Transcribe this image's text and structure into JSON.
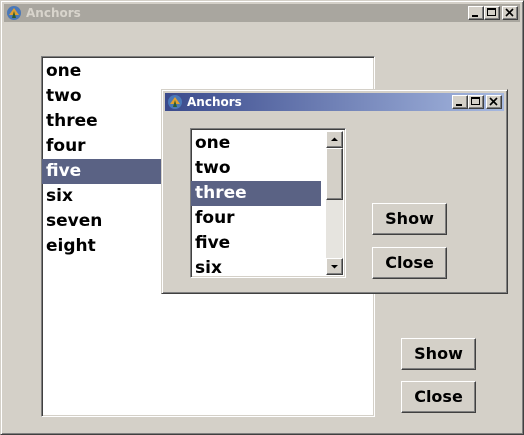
{
  "main_window": {
    "title": "Anchors",
    "list_items": [
      "one",
      "two",
      "three",
      "four",
      "five",
      "six",
      "seven",
      "eight"
    ],
    "selected_item": "five",
    "show_label": "Show",
    "close_label": "Close"
  },
  "child_window": {
    "title": "Anchors",
    "list_items": [
      "one",
      "two",
      "three",
      "four",
      "five",
      "six"
    ],
    "selected_item": "three",
    "show_label": "Show",
    "close_label": "Close"
  },
  "icons": [
    "app-icon",
    "minimize-icon",
    "maximize-icon",
    "close-icon",
    "scroll-up-icon",
    "scroll-down-icon"
  ]
}
